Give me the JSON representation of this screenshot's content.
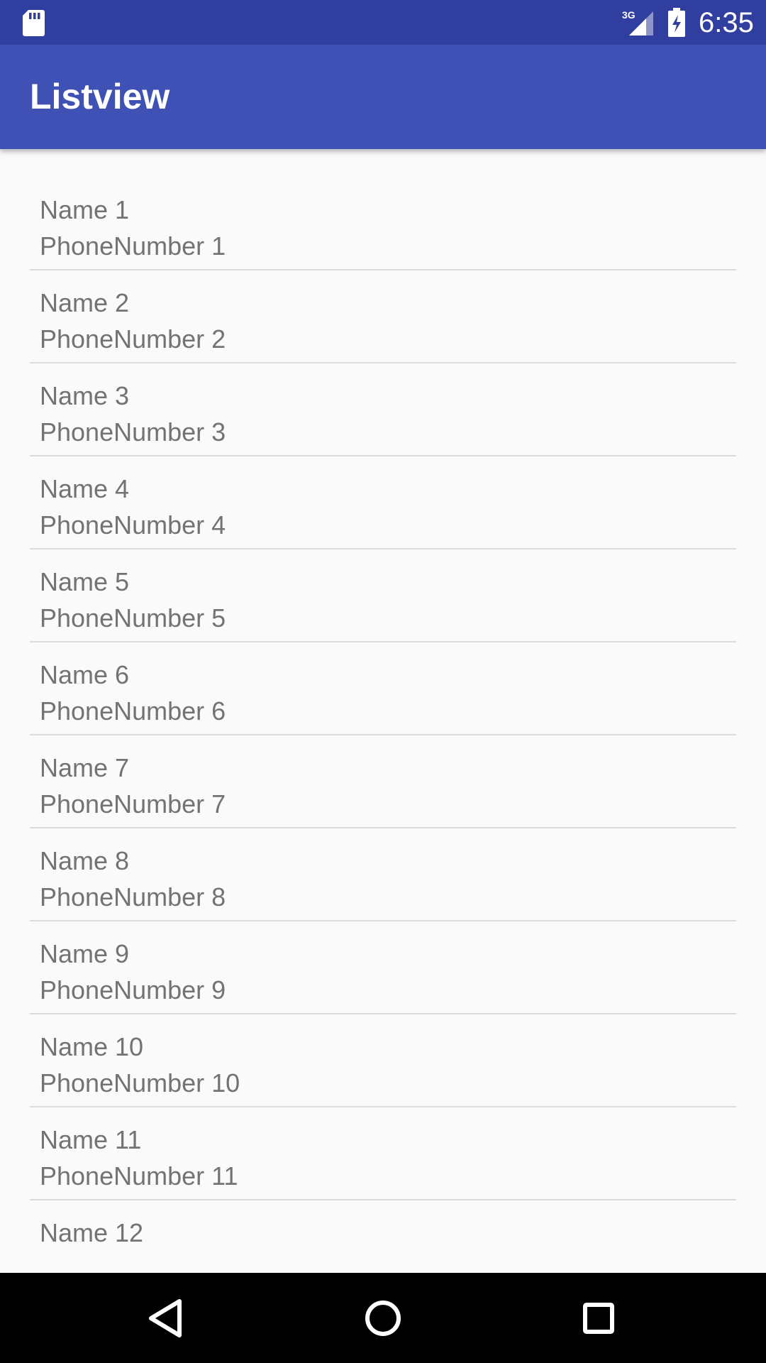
{
  "status_bar": {
    "network": "3G",
    "time": "6:35",
    "icons": [
      "sd-card-icon",
      "cell-signal-icon",
      "battery-charging-icon"
    ]
  },
  "app_bar": {
    "title": "Listview",
    "color": "#3f51b5",
    "status_color": "#303f9f"
  },
  "contacts": [
    {
      "name": "Name 1",
      "phone": "PhoneNumber 1"
    },
    {
      "name": "Name 2",
      "phone": "PhoneNumber 2"
    },
    {
      "name": "Name 3",
      "phone": "PhoneNumber 3"
    },
    {
      "name": "Name 4",
      "phone": "PhoneNumber 4"
    },
    {
      "name": "Name 5",
      "phone": "PhoneNumber 5"
    },
    {
      "name": "Name 6",
      "phone": "PhoneNumber 6"
    },
    {
      "name": "Name 7",
      "phone": "PhoneNumber 7"
    },
    {
      "name": "Name 8",
      "phone": "PhoneNumber 8"
    },
    {
      "name": "Name 9",
      "phone": "PhoneNumber 9"
    },
    {
      "name": "Name 10",
      "phone": "PhoneNumber 10"
    },
    {
      "name": "Name 11",
      "phone": "PhoneNumber 11"
    },
    {
      "name": "Name 12",
      "phone": ""
    }
  ],
  "nav_bar": {
    "icons": [
      "back-icon",
      "home-icon",
      "recents-icon"
    ]
  }
}
